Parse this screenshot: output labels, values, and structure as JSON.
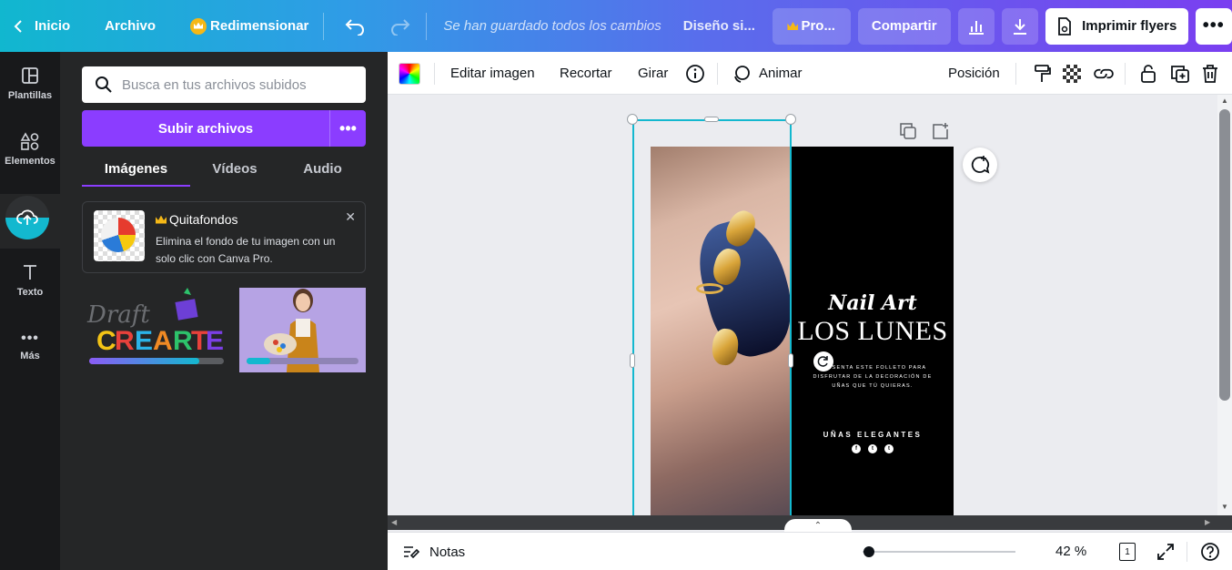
{
  "topbar": {
    "home_label": "Inicio",
    "file_label": "Archivo",
    "resize_label": "Redimensionar",
    "saved_status": "Se han guardado todos los cambios",
    "design_title": "Diseño si...",
    "pro_label": "Pro...",
    "share_label": "Compartir",
    "print_label": "Imprimir flyers"
  },
  "rail": {
    "items": [
      {
        "label": "Plantillas",
        "icon": "templates-icon"
      },
      {
        "label": "Elementos",
        "icon": "elements-icon"
      },
      {
        "label": "",
        "icon": "upload-icon"
      },
      {
        "label": "Texto",
        "icon": "text-icon"
      },
      {
        "label": "Más",
        "icon": "more-icon"
      }
    ]
  },
  "panel": {
    "search_placeholder": "Busca en tus archivos subidos",
    "upload_label": "Subir archivos",
    "tabs": [
      "Imágenes",
      "Vídeos",
      "Audio"
    ],
    "active_tab": "Imágenes",
    "promo": {
      "title": "Quitafondos",
      "description": "Elimina el fondo de tu imagen con un solo clic con Canva Pro."
    }
  },
  "toolbar": {
    "edit_image": "Editar imagen",
    "crop": "Recortar",
    "flip": "Girar",
    "animate": "Animar",
    "position": "Posición"
  },
  "design": {
    "heading_script": "Nail Art",
    "heading_main": "LOS LUNES",
    "body": "PRESENTA ESTE FOLLETO PARA DISFRUTAR DE LA DECORACIÓN DE UÑAS QUE TÚ QUIERAS.",
    "footer": "UÑAS ELEGANTES",
    "social": [
      "f",
      "t",
      "t"
    ]
  },
  "bottombar": {
    "notes_label": "Notas",
    "zoom_label": "42 %",
    "zoom_fraction": 0.04,
    "page_count": "1"
  },
  "colors": {
    "accent": "#8b3dff",
    "selection": "#13b8cf",
    "panel_bg": "#252627",
    "rail_bg": "#18191b"
  }
}
